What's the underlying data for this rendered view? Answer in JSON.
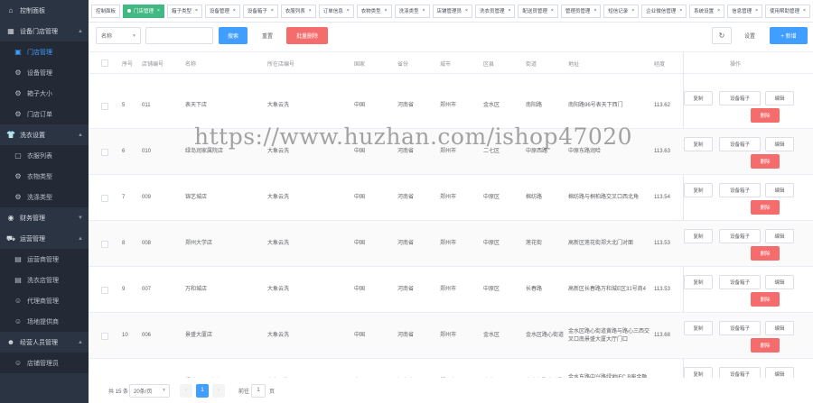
{
  "sidebar": {
    "items": [
      {
        "type": "group",
        "icon": "home-icon",
        "label": "控制面板",
        "arrow": ""
      },
      {
        "type": "group",
        "icon": "grid-icon",
        "label": "设备门店管理",
        "arrow": "▲"
      },
      {
        "type": "sub",
        "icon": "store-icon",
        "label": "门店管理",
        "active": true
      },
      {
        "type": "sub",
        "icon": "gear-icon",
        "label": "设备管理"
      },
      {
        "type": "sub",
        "icon": "gear-icon",
        "label": "箱子大小"
      },
      {
        "type": "sub",
        "icon": "gear-icon",
        "label": "门店订单"
      },
      {
        "type": "group",
        "icon": "tshirt-icon",
        "label": "洗衣设置",
        "arrow": "▲"
      },
      {
        "type": "sub",
        "icon": "bag-icon",
        "label": "衣服列表"
      },
      {
        "type": "sub",
        "icon": "gear-icon",
        "label": "衣物类型"
      },
      {
        "type": "sub",
        "icon": "gear-icon",
        "label": "洗涤类型"
      },
      {
        "type": "group",
        "icon": "money-icon",
        "label": "财务管理",
        "arrow": "▼"
      },
      {
        "type": "group",
        "icon": "truck-icon",
        "label": "运营管理",
        "arrow": "▲"
      },
      {
        "type": "sub",
        "icon": "building-icon",
        "label": "运营商管理"
      },
      {
        "type": "sub",
        "icon": "building-icon",
        "label": "洗衣店管理"
      },
      {
        "type": "sub",
        "icon": "user-icon",
        "label": "代理商管理"
      },
      {
        "type": "sub",
        "icon": "user-icon",
        "label": "场地提供商"
      },
      {
        "type": "group",
        "icon": "people-icon",
        "label": "经营人员管理",
        "arrow": "▲"
      },
      {
        "type": "sub",
        "icon": "user-icon",
        "label": "店铺管理员"
      }
    ]
  },
  "tags": [
    {
      "label": "控制面板",
      "active": false,
      "closable": false
    },
    {
      "label": "门店管理",
      "active": true,
      "closable": true
    },
    {
      "label": "箱子类型",
      "active": false,
      "closable": true
    },
    {
      "label": "设备管理",
      "active": false,
      "closable": true
    },
    {
      "label": "设备箱子",
      "active": false,
      "closable": true
    },
    {
      "label": "衣服列表",
      "active": false,
      "closable": true
    },
    {
      "label": "订单信息",
      "active": false,
      "closable": true
    },
    {
      "label": "衣物类型",
      "active": false,
      "closable": true
    },
    {
      "label": "洗涤类型",
      "active": false,
      "closable": true
    },
    {
      "label": "店铺管理员",
      "active": false,
      "closable": true
    },
    {
      "label": "洗衣员管理",
      "active": false,
      "closable": true
    },
    {
      "label": "配送员管理",
      "active": false,
      "closable": true
    },
    {
      "label": "管理员管理",
      "active": false,
      "closable": true
    },
    {
      "label": "短信记录",
      "active": false,
      "closable": true
    },
    {
      "label": "企业微信管理",
      "active": false,
      "closable": true
    },
    {
      "label": "系统设置",
      "active": false,
      "closable": true
    },
    {
      "label": "信息管理",
      "active": false,
      "closable": true
    },
    {
      "label": "使用帮助管理",
      "active": false,
      "closable": true
    }
  ],
  "search": {
    "field_select": "名称",
    "keyword_placeholder": "",
    "search_label": "搜索",
    "reset_label": "重置",
    "batch_delete_label": "批量删除",
    "refresh_icon": "↻",
    "settings_label": "设置",
    "add_label": "+ 新增"
  },
  "table": {
    "headers": {
      "index": "序号",
      "code": "店铺编号",
      "name": "名称",
      "owner": "所在店编号",
      "country": "国家",
      "province": "省份",
      "city": "城市",
      "district": "区县",
      "street": "街道",
      "address": "地址",
      "lng": "经度",
      "ops": "操作"
    },
    "ops": {
      "copy": "复制",
      "boxes": "设备箱子",
      "edit": "编辑",
      "delete": "删除"
    },
    "rows": [
      {
        "index": "5",
        "code": "011",
        "name": "表天下店",
        "owner": "大象云洗",
        "country": "中国",
        "province": "河南省",
        "city": "郑州市",
        "district": "金水区",
        "street": "南阳路",
        "address": "南阳路96号表天下西门",
        "lng": "113.62"
      },
      {
        "index": "6",
        "code": "010",
        "name": "绿岛润家属院店",
        "owner": "大象云洗",
        "country": "中国",
        "province": "河南省",
        "city": "郑州市",
        "district": "二七区",
        "street": "中原西路",
        "address": "中原东路润哈",
        "lng": "113.63"
      },
      {
        "index": "7",
        "code": "009",
        "name": "锦艺城店",
        "owner": "大象云洗",
        "country": "中国",
        "province": "河南省",
        "city": "郑州市",
        "district": "中原区",
        "street": "棉纺路",
        "address": "棉纺路与桐柏路交叉口西北角",
        "lng": "113.54"
      },
      {
        "index": "8",
        "code": "008",
        "name": "郑州大学店",
        "owner": "大象云洗",
        "country": "中国",
        "province": "河南省",
        "city": "郑州市",
        "district": "中原区",
        "street": "莲花街",
        "address": "高新区莲花街郑大北门对面",
        "lng": "113.53"
      },
      {
        "index": "9",
        "code": "007",
        "name": "万和城店",
        "owner": "大象云洗",
        "country": "中国",
        "province": "河南省",
        "city": "郑州市",
        "district": "中原区",
        "street": "长春路",
        "address": "高新区长春路万和城E区31号商4",
        "lng": "113.53"
      },
      {
        "index": "10",
        "code": "006",
        "name": "景盛大厦店",
        "owner": "大象云洗",
        "country": "中国",
        "province": "河南省",
        "city": "郑州市",
        "district": "金水区",
        "street": "金水区路心街道",
        "address": "金水区路心街道黄路与路心三西交叉口南景盛大厦大厅门口",
        "lng": "113.68"
      },
      {
        "index": "11",
        "code": "005",
        "name": "绿地IFC B座店",
        "owner": "大象云洗",
        "country": "中国",
        "province": "河南省",
        "city": "郑州市",
        "district": "金水区",
        "street": "金水东路中兴路",
        "address": "金水东路中兴路绿地IFC B座金融服务中心",
        "lng": "113.72"
      }
    ]
  },
  "pager": {
    "total": "共 15 条",
    "page_size": "20条/页",
    "prev": "‹",
    "current": "1",
    "next": "›",
    "goto": "前往",
    "goto_value": "1",
    "unit": "页"
  },
  "watermark": "https://www.huzhan.com/ishop47020",
  "colors": {
    "sidebar_bg": "#2b3442",
    "primary": "#409eff",
    "danger": "#f56c6c",
    "tag_active": "#42b983"
  }
}
